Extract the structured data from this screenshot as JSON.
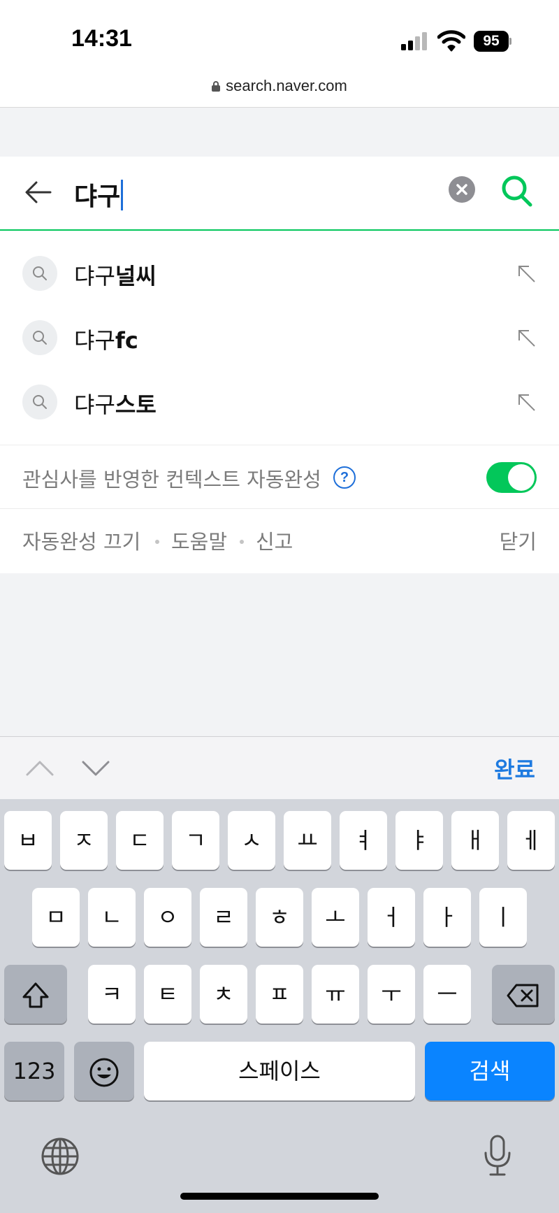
{
  "status_bar": {
    "time": "14:31",
    "battery": "95"
  },
  "browser": {
    "url": "search.naver.com"
  },
  "search": {
    "query": "댜구"
  },
  "suggestions": [
    {
      "prefix": "댜구",
      "suffix": "널씨"
    },
    {
      "prefix": "댜구",
      "suffix": "fc"
    },
    {
      "prefix": "댜구",
      "suffix": "스토"
    }
  ],
  "context": {
    "label": "관심사를 반영한 컨텍스트 자동완성",
    "help": "?",
    "toggle_on": true
  },
  "footer": {
    "autocomplete_off": "자동완성 끄기",
    "help": "도움말",
    "report": "신고",
    "close": "닫기"
  },
  "accessory": {
    "done": "완료"
  },
  "keyboard": {
    "row1": [
      "ㅂ",
      "ㅈ",
      "ㄷ",
      "ㄱ",
      "ㅅ",
      "ㅛ",
      "ㅕ",
      "ㅑ",
      "ㅐ",
      "ㅔ"
    ],
    "row2": [
      "ㅁ",
      "ㄴ",
      "ㅇ",
      "ㄹ",
      "ㅎ",
      "ㅗ",
      "ㅓ",
      "ㅏ",
      "ㅣ"
    ],
    "row3": [
      "ㅋ",
      "ㅌ",
      "ㅊ",
      "ㅍ",
      "ㅠ",
      "ㅜ",
      "ㅡ"
    ],
    "numbers": "123",
    "space": "스페이스",
    "search": "검색"
  },
  "colors": {
    "naver_green": "#03c75a",
    "ios_blue": "#0a84ff",
    "link_blue": "#1e6fd9"
  }
}
